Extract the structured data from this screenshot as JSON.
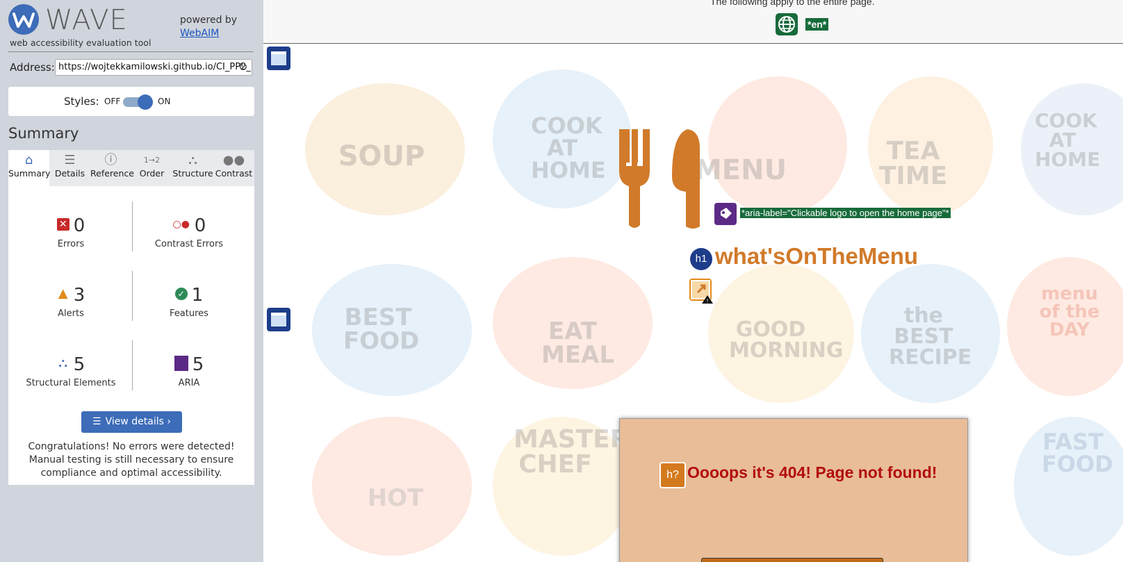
{
  "sidebar": {
    "logo_text": "WAVE",
    "tagline": "web accessibility evaluation tool",
    "powered_by": "powered by",
    "webaim_link": "WebAIM",
    "address_label": "Address:",
    "address_value": "https://wojtekkamilowski.github.io/CI_PP2_",
    "styles_label": "Styles:",
    "styles_off": "OFF",
    "styles_on": "ON",
    "summary_title": "Summary",
    "tabs": [
      {
        "label": "Summary",
        "icon": "home-icon"
      },
      {
        "label": "Details",
        "icon": "list-icon"
      },
      {
        "label": "Reference",
        "icon": "info-icon"
      },
      {
        "label": "Order",
        "icon": "order-icon"
      },
      {
        "label": "Structure",
        "icon": "structure-icon"
      },
      {
        "label": "Contrast",
        "icon": "contrast-icon"
      }
    ],
    "stats": [
      {
        "label": "Errors",
        "value": "0",
        "icon": "error-x-icon"
      },
      {
        "label": "Contrast Errors",
        "value": "0",
        "icon": "contrast-error-icon"
      },
      {
        "label": "Alerts",
        "value": "3",
        "icon": "alert-triangle-icon"
      },
      {
        "label": "Features",
        "value": "1",
        "icon": "feature-check-icon"
      },
      {
        "label": "Structural Elements",
        "value": "5",
        "icon": "structure-icon"
      },
      {
        "label": "ARIA",
        "value": "5",
        "icon": "aria-icon"
      }
    ],
    "view_details": "View details ›",
    "congrats": "Congratulations! No errors were detected! Manual testing is still necessary to ensure compliance and optimal accessibility."
  },
  "main": {
    "top_note": "The following apply to the entire page.",
    "lang_tag": "*en*",
    "aria_label": "*aria-label=\"Clickable logo to open the home page\"*",
    "h1_badge": "h1",
    "heading": "what'sOnTheMenu",
    "doodles": [
      "SOUP",
      "COOK AT HOME",
      "MENU",
      "TEA TIME",
      "COOK AT HOME",
      "BEST FOOD",
      "EAT MEAL",
      "GOOD MORNING",
      "the BEST RECIPE",
      "menu of the DAY",
      "HOT",
      "MASTER CHEF",
      "FAST FOOD"
    ],
    "possible_heading_badge": "h?",
    "error_title": "Oooops it's 404! Page not found!"
  },
  "colors": {
    "accent": "#3d6cb8",
    "brand_orange": "#d17a2a",
    "tag_green": "#176b3b",
    "aria_purple": "#5b2a86",
    "error_red": "#b30d0d"
  }
}
